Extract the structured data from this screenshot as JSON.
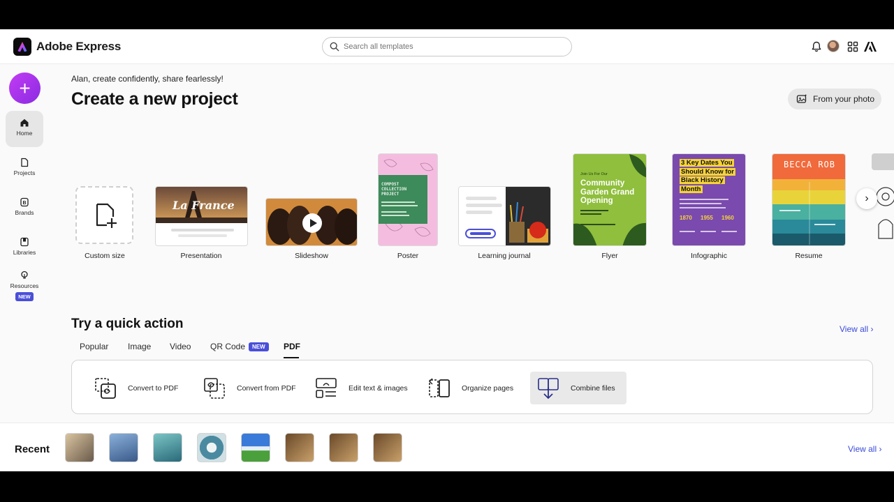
{
  "header": {
    "app_title": "Adobe Express",
    "search_placeholder": "Search all templates"
  },
  "sidebar": {
    "items": [
      {
        "label": "Home"
      },
      {
        "label": "Projects"
      },
      {
        "label": "Brands"
      },
      {
        "label": "Libraries"
      },
      {
        "label": "Resources",
        "badge": "NEW"
      }
    ]
  },
  "main": {
    "greeting": "Alan, create confidently, share fearlessly!",
    "title": "Create a new project",
    "from_photo_label": "From your photo",
    "templates": [
      {
        "label": "Custom size"
      },
      {
        "label": "Presentation",
        "thumb_text": "La France"
      },
      {
        "label": "Slideshow"
      },
      {
        "label": "Poster",
        "thumb_text": "COMPOST COLLECTION PROJECT"
      },
      {
        "label": "Learning journal"
      },
      {
        "label": "Flyer",
        "thumb_text": "Community Garden Grand Opening",
        "thumb_kicker": "Join Us For Our"
      },
      {
        "label": "Infographic",
        "thumb_text": "3 Key Dates You Should Know for Black History Month",
        "thumb_years": [
          "1870",
          "1955",
          "1960"
        ]
      },
      {
        "label": "Resume",
        "thumb_text": "BECCA ROB"
      }
    ]
  },
  "quick_actions": {
    "title": "Try a quick action",
    "view_all": "View all",
    "tabs": [
      {
        "label": "Popular"
      },
      {
        "label": "Image"
      },
      {
        "label": "Video"
      },
      {
        "label": "QR Code",
        "badge": "NEW"
      },
      {
        "label": "PDF"
      }
    ],
    "actions": [
      {
        "label": "Convert to PDF"
      },
      {
        "label": "Convert from PDF"
      },
      {
        "label": "Edit text & images"
      },
      {
        "label": "Organize pages"
      },
      {
        "label": "Combine files"
      }
    ]
  },
  "recent": {
    "title": "Recent",
    "view_all": "View all"
  },
  "colors": {
    "accent": "#3a4ad9",
    "fab": "#a537f0",
    "badge": "#4a4fd8"
  }
}
